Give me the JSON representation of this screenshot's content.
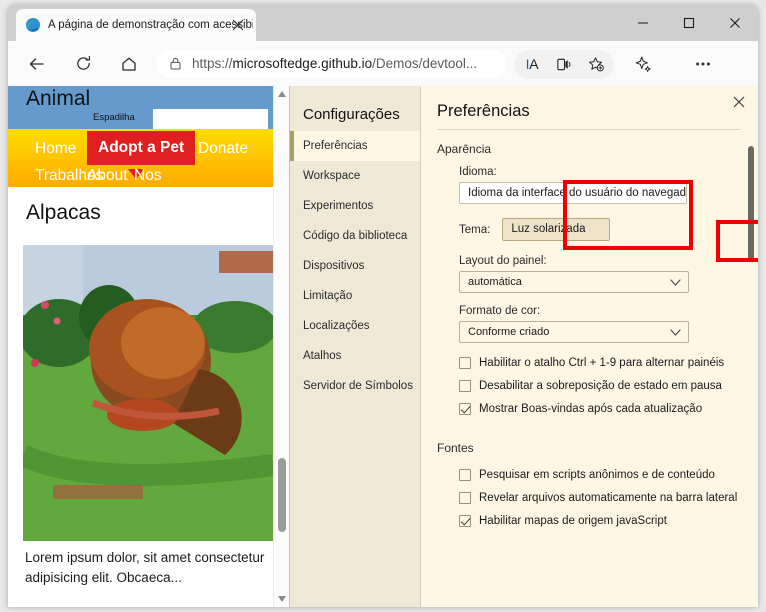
{
  "browser": {
    "tab": {
      "title": "A página de demonstração com acessibilidade é",
      "favicon": "edge-logo-icon",
      "close": "close-icon"
    },
    "window_controls": {
      "minimize": "minimize-icon",
      "maximize": "maximize-icon",
      "close": "close-icon"
    },
    "toolbar": {
      "back": "back-arrow-icon",
      "refresh": "refresh-icon",
      "home": "home-icon",
      "lock": "lock-icon",
      "url_prefix": "https://",
      "url_domain": "microsoftedge.github.io",
      "url_path": "/Demos/devtool...",
      "url_full": "https://microsoftedge.github.io/Demos/devtool...",
      "immersive_reader": "IA",
      "read_aloud": "read-aloud-icon",
      "add_favorite": "add-favorite-star-icon",
      "copilot": "copilot-sparkle-icon",
      "settings_more": "ellipsis-icon"
    }
  },
  "page": {
    "site_title": "Animal",
    "site_subtitle": "Espadilha",
    "nav": [
      {
        "label": "Home",
        "name": "nav-home"
      },
      {
        "label": "Adopt a Pet",
        "name": "nav-adopt-a-pet"
      },
      {
        "label": "Donate",
        "name": "nav-donate"
      },
      {
        "label": "Trabalhos",
        "name": "nav-trabalhos"
      },
      {
        "label": "About",
        "name": "nav-about"
      },
      {
        "label": "Nos",
        "name": "nav-nos"
      }
    ],
    "article_title": "Alpacas",
    "article_text": "Lorem ipsum dolor, sit amet consectetur adipisicing elit. Obcaeca...",
    "photo_alt": "alpaca-photo",
    "scrollbar": {
      "up": "scroll-up-arrow-icon",
      "down": "scroll-down-arrow-icon"
    }
  },
  "devtools": {
    "close": "close-icon",
    "nav_title": "Configurações",
    "nav_items": [
      {
        "label": "Preferências",
        "selected": true
      },
      {
        "label": "Workspace",
        "selected": false
      },
      {
        "label": "Experimentos",
        "selected": false
      },
      {
        "label": "Código da biblioteca",
        "selected": false
      },
      {
        "label": "Dispositivos",
        "selected": false
      },
      {
        "label": "Limitação",
        "selected": false
      },
      {
        "label": "Localizações",
        "selected": false
      },
      {
        "label": "Atalhos",
        "selected": false
      },
      {
        "label": "Servidor de Símbolos",
        "selected": false
      }
    ],
    "panel_title": "Preferências",
    "sections": {
      "appearance": {
        "heading": "Aparência",
        "language_label": "Idioma:",
        "language_value": "Idioma da interface do usuário do navegador",
        "theme_label": "Tema:",
        "theme_value": "Luz solarizada",
        "panel_layout_label": "Layout do painel:",
        "panel_layout_value": "automática",
        "color_format_label": "Formato de cor:",
        "color_format_value": "Conforme criado",
        "checkboxes": [
          {
            "label": "Habilitar o atalho Ctrl + 1-9 para alternar painéis",
            "checked": false
          },
          {
            "label": "Desabilitar a sobreposição de estado em pausa",
            "checked": false
          },
          {
            "label": "Mostrar Boas-vindas após cada atualização",
            "checked": true
          }
        ]
      },
      "sources": {
        "heading": "Fontes",
        "checkboxes": [
          {
            "label": "Pesquisar em scripts anônimos e de conteúdo",
            "checked": false
          },
          {
            "label": "Revelar arquivos automaticamente na barra lateral",
            "checked": false
          },
          {
            "label": "Habilitar mapas de origem javaScript",
            "checked": true
          }
        ]
      }
    }
  },
  "annotations": {
    "highlight_color": "#ee0000",
    "boxes": [
      {
        "name": "highlight-configuracoes",
        "target": "Configurações / Preferências"
      },
      {
        "name": "highlight-tema",
        "target": "Tema: Luz solarizada"
      }
    ]
  },
  "colors": {
    "devtools_bg": "#fdf6e3",
    "devtools_nav_bg": "#eee8d5",
    "nav_selected_accent": "#a8a06a",
    "page_hero": "#6699cc",
    "page_nav_from": "#ffdd00",
    "page_nav_to": "#ffaa00",
    "adopt_badge": "#e02020",
    "highlight": "#ee0000"
  }
}
